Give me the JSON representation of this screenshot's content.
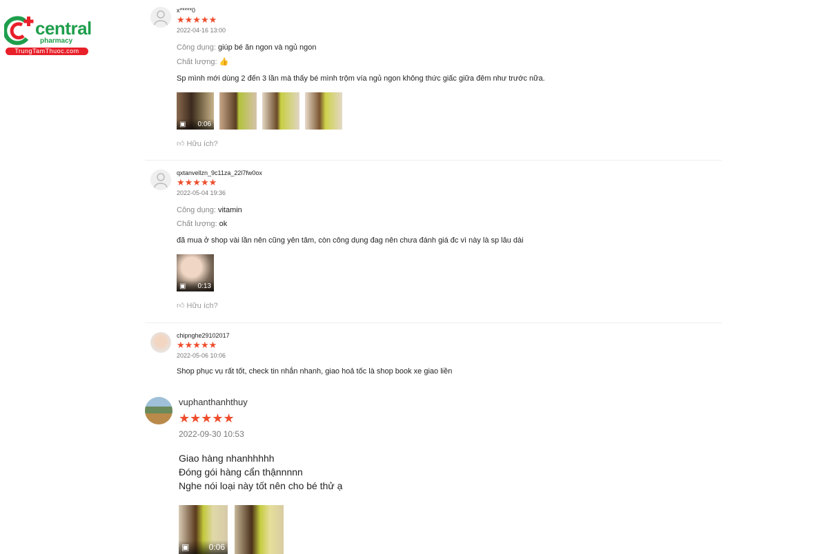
{
  "logo": {
    "brand": "central",
    "sub": "pharmacy",
    "tagline": "TrungTamThuoc.com"
  },
  "labels": {
    "usage": "Công dụng:",
    "quality": "Chất lượng:",
    "helpful": "Hữu ích?"
  },
  "stars": "★★★★★",
  "accent_color": "#ee4d2d",
  "reviews": [
    {
      "username": "x*****0",
      "date": "2022-04-16 13:00",
      "usage_value": "giúp bé ăn ngon và ngủ ngon",
      "quality_icon": "thumbs-up-icon",
      "comment": "Sp mình mới dùng 2 đến 3 lần mà thấy bé mình trộm vía ngủ ngon không thức giấc giữa đêm như trước nữa.",
      "video_duration": "0:06"
    },
    {
      "username": "qxtanvellzn_9c11za_22l7fw0ox",
      "date": "2022-05-04 19:36",
      "usage_value": "vitamin",
      "quality_value": "ok",
      "comment": "đã mua ở shop vài lần nên cũng yên tâm, còn công dụng đag nên chưa đánh giá đc vì này là sp lâu dài",
      "video_duration": "0:13"
    },
    {
      "username": "chipnghe29102017",
      "date": "2022-05-06 10:06",
      "comment": "Shop phục vụ rất tốt, check tin nhắn nhanh, giao hoả tốc là shop book xe giao liền"
    },
    {
      "username": "vuphanthanhthuy",
      "date": "2022-09-30 10:53",
      "comment_lines": [
        "Giao hàng nhanhhhhh",
        "Đóng gói hàng cẩn thậnnnnn",
        "Nghe nói loại này tốt nên cho bé thử ạ"
      ],
      "video_duration": "0:06"
    }
  ]
}
